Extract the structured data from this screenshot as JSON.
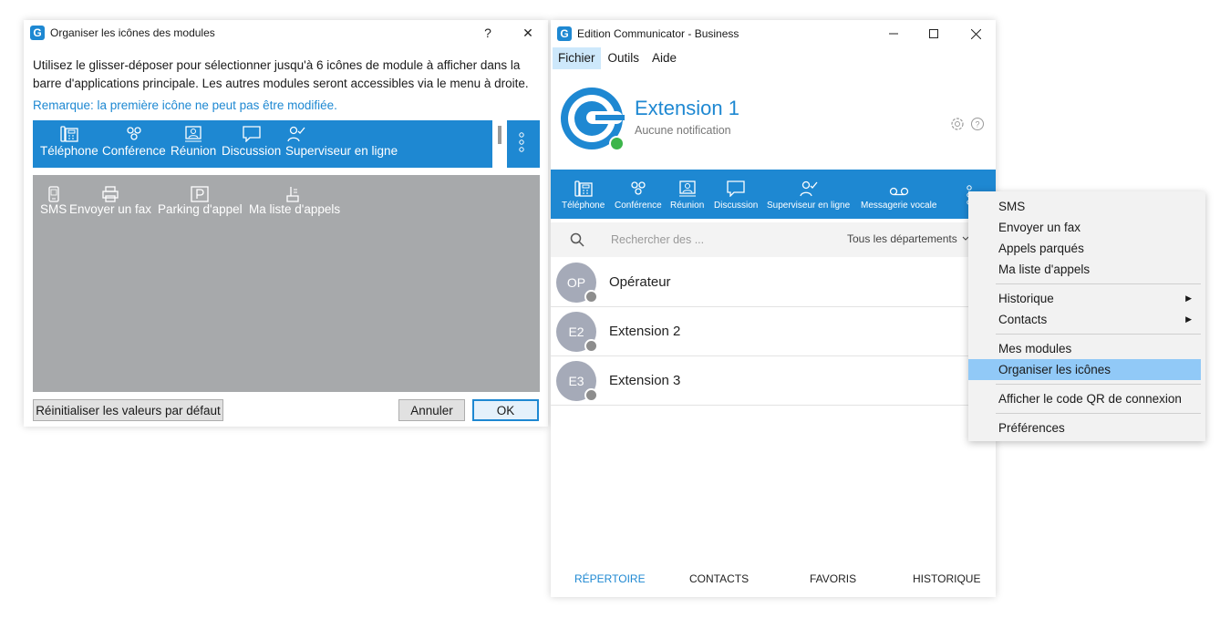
{
  "dialog": {
    "title": "Organiser les icônes des modules",
    "help": "?",
    "close": "✕",
    "description_line1": "Utilisez le glisser-déposer pour sélectionner jusqu'à 6 icônes de module à afficher dans la",
    "description_line2": "barre d'applications principale. Les autres modules seront accessibles via le menu à droite.",
    "note": "Remarque: la première icône ne peut pas être modifiée.",
    "selected_modules": [
      {
        "label": "Téléphone",
        "icon": "phone-icon"
      },
      {
        "label": "Conférence",
        "icon": "conference-icon"
      },
      {
        "label": "Réunion",
        "icon": "meeting-icon"
      },
      {
        "label": "Discussion",
        "icon": "chat-icon"
      },
      {
        "label": "Superviseur en ligne",
        "icon": "supervisor-icon"
      }
    ],
    "available_modules": [
      {
        "label": "SMS",
        "icon": "sms-icon"
      },
      {
        "label": "Envoyer un fax",
        "icon": "fax-icon"
      },
      {
        "label": "Parking d'appel",
        "icon": "parking-icon"
      },
      {
        "label": "Ma liste d'appels",
        "icon": "call-list-icon"
      }
    ],
    "reset_label": "Réinitialiser les valeurs par défaut",
    "cancel_label": "Annuler",
    "ok_label": "OK"
  },
  "main_window": {
    "title": "Edition Communicator - Business",
    "menu": [
      "Fichier",
      "Outils",
      "Aide"
    ],
    "profile": {
      "name": "Extension 1",
      "status": "Aucune notification",
      "presence_color": "#3cb54a"
    },
    "nav": [
      {
        "label": "Téléphone",
        "icon": "phone-icon"
      },
      {
        "label": "Conférence",
        "icon": "conference-icon"
      },
      {
        "label": "Réunion",
        "icon": "meeting-icon"
      },
      {
        "label": "Discussion",
        "icon": "chat-icon"
      },
      {
        "label": "Superviseur en ligne",
        "icon": "supervisor-icon"
      },
      {
        "label": "Messagerie vocale",
        "icon": "voicemail-icon"
      }
    ],
    "search": {
      "placeholder": "Rechercher des ...",
      "department": "Tous les départements"
    },
    "contacts": [
      {
        "initials": "OP",
        "name": "Opérateur"
      },
      {
        "initials": "E2",
        "name": "Extension 2"
      },
      {
        "initials": "E3",
        "name": "Extension 3"
      }
    ],
    "tabs": [
      "RÉPERTOIRE",
      "CONTACTS",
      "FAVORIS",
      "HISTORIQUE"
    ],
    "active_tab": "RÉPERTOIRE"
  },
  "context_menu": {
    "items": [
      "SMS",
      "Envoyer un fax",
      "Appels parqués",
      "Ma liste d'appels",
      "Historique",
      "Contacts",
      "Mes modules",
      "Organiser les icônes",
      "Afficher le code QR de connexion",
      "Préférences"
    ],
    "highlighted": "Organiser les icônes"
  },
  "colors": {
    "accent": "#1e88d2",
    "gray_area": "#a7a9ab",
    "highlight": "#91c9f7"
  }
}
